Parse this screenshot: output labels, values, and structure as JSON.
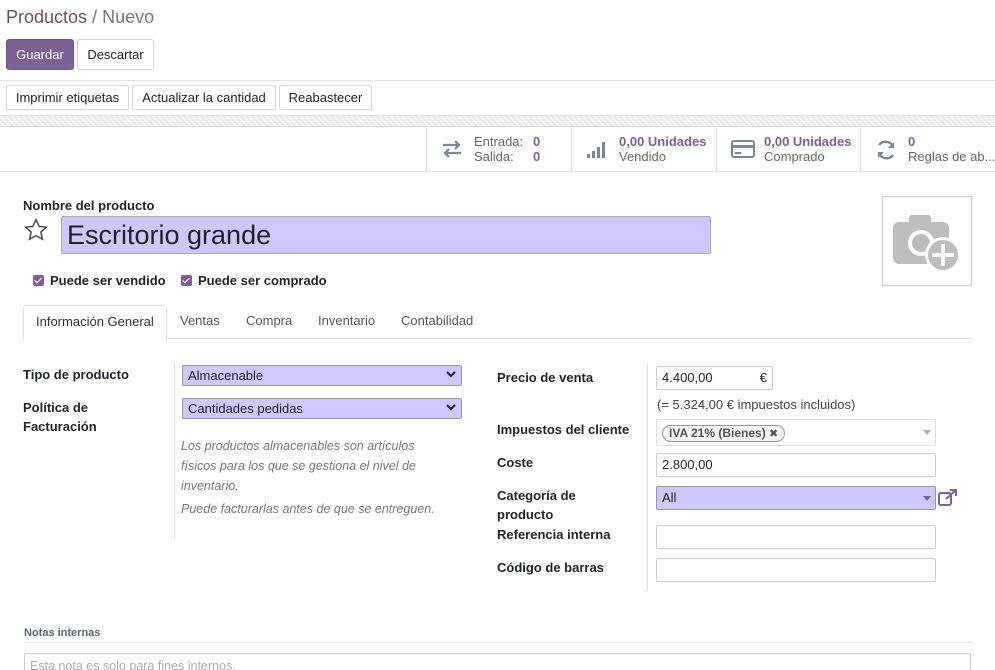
{
  "breadcrumb": {
    "parent": "Productos",
    "separator": "/",
    "current": "Nuevo"
  },
  "control": {
    "save_label": "Guardar",
    "discard_label": "Descartar"
  },
  "actions": {
    "print_labels": "Imprimir etiquetas",
    "update_qty": "Actualizar la cantidad",
    "replenish": "Reabastecer"
  },
  "stats": {
    "in_label": "Entrada:",
    "in_value": "0",
    "out_label": "Salida:",
    "out_value": "0",
    "sold_value": "0,00 Unidades",
    "sold_label": "Vendido",
    "bought_value": "0,00 Unidades",
    "bought_label": "Comprado",
    "rules_value": "0",
    "rules_label": "Reglas de ab..."
  },
  "product": {
    "name_label": "Nombre del producto",
    "name": "Escritorio grande",
    "can_be_sold": "Puede ser vendido",
    "can_be_purchased": "Puede ser comprado"
  },
  "tabs": [
    "Información General",
    "Ventas",
    "Compra",
    "Inventario",
    "Contabilidad"
  ],
  "general": {
    "type_label": "Tipo de producto",
    "type_value": "Almacenable",
    "invoice_label_1": "Política de",
    "invoice_label_2": "Facturación",
    "invoice_value": "Cantidades pedidas",
    "help_1_line_1": "Los productos almacenables son artículos",
    "help_1_line_2": "físicos para los que se gestiona el nivel de",
    "help_1_line_3": "inventario.",
    "help_2": "Puede facturarlas antes de que se entreguen.",
    "price_label": "Precio de venta",
    "price_value": "4.400,00",
    "currency": "€",
    "price_incl": "(= 5.324,00 € impuestos incluidos)",
    "taxes_label": "Impuestos del cliente",
    "tax_tag": "IVA 21% (Bienes)",
    "cost_label": "Coste",
    "cost_value": "2.800,00",
    "category_label_1": "Categoría de",
    "category_label_2": "producto",
    "category_value": "All",
    "ref_label": "Referencia interna",
    "ref_value": "",
    "barcode_label": "Código de barras",
    "barcode_value": ""
  },
  "notes": {
    "label": "Notas internas",
    "placeholder": "Esta nota es solo para fines internos."
  },
  "colors": {
    "brand": "#7c6096",
    "field_highlight": "#cdc8ff"
  }
}
